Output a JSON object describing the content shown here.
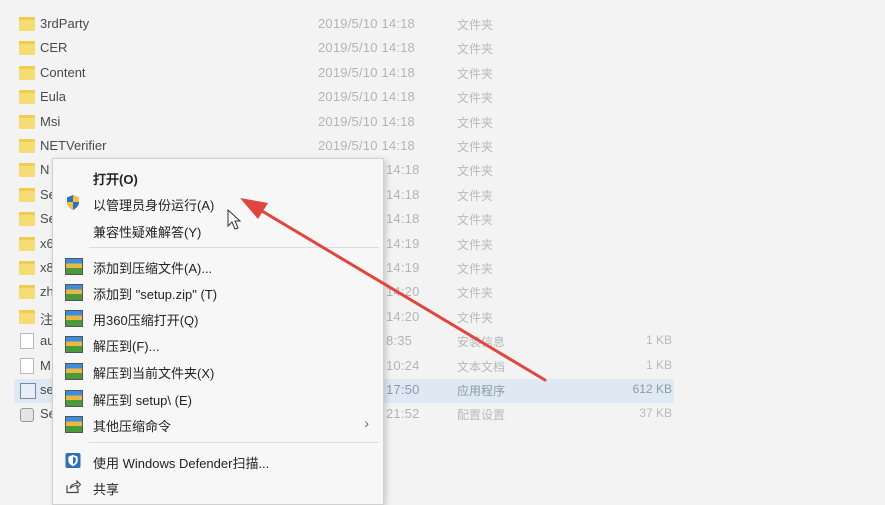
{
  "files": [
    {
      "name": "3rdParty",
      "date": "2019/5/10 14:18",
      "type": "文件夹",
      "size": "",
      "icon": "folder-icon"
    },
    {
      "name": "CER",
      "date": "2019/5/10 14:18",
      "type": "文件夹",
      "size": "",
      "icon": "folder-icon"
    },
    {
      "name": "Content",
      "date": "2019/5/10 14:18",
      "type": "文件夹",
      "size": "",
      "icon": "folder-icon"
    },
    {
      "name": "Eula",
      "date": "2019/5/10 14:18",
      "type": "文件夹",
      "size": "",
      "icon": "folder-icon"
    },
    {
      "name": "Msi",
      "date": "2019/5/10 14:18",
      "type": "文件夹",
      "size": "",
      "icon": "folder-icon"
    },
    {
      "name": "NETVerifier",
      "date": "2019/5/10 14:18",
      "type": "文件夹",
      "size": "",
      "icon": "folder-icon"
    },
    {
      "name": "N",
      "date": "14:18",
      "type": "文件夹",
      "size": "",
      "icon": "folder-icon"
    },
    {
      "name": "Se",
      "date": "14:18",
      "type": "文件夹",
      "size": "",
      "icon": "folder-icon"
    },
    {
      "name": "Se",
      "date": "14:18",
      "type": "文件夹",
      "size": "",
      "icon": "folder-icon"
    },
    {
      "name": "x6",
      "date": "14:19",
      "type": "文件夹",
      "size": "",
      "icon": "folder-icon"
    },
    {
      "name": "x8",
      "date": "14:19",
      "type": "文件夹",
      "size": "",
      "icon": "folder-icon"
    },
    {
      "name": "zh",
      "date": "14:20",
      "type": "文件夹",
      "size": "",
      "icon": "folder-icon"
    },
    {
      "name": "注",
      "date": "14:20",
      "type": "文件夹",
      "size": "",
      "icon": "folder-icon"
    },
    {
      "name": "au",
      "date": "8:35",
      "type": "安装信息",
      "size": "1 KB",
      "icon": "file-icon"
    },
    {
      "name": "M",
      "date": "10:24",
      "type": "文本文档",
      "size": "1 KB",
      "icon": "file-icon"
    },
    {
      "name": "se",
      "date": "17:50",
      "type": "应用程序",
      "size": "612 KB",
      "icon": "app-icon"
    },
    {
      "name": "Se",
      "date": "21:52",
      "type": "配置设置",
      "size": "37 KB",
      "icon": "settings-file-icon"
    }
  ],
  "menu": {
    "open": "打开(O)",
    "run_as_admin": "以管理员身份运行(A)",
    "compat": "兼容性疑难解答(Y)",
    "add_archive": "添加到压缩文件(A)...",
    "add_zip": "添加到 \"setup.zip\" (T)",
    "open_360": "用360压缩打开(Q)",
    "extract_to": "解压到(F)...",
    "extract_here": "解压到当前文件夹(X)",
    "extract_setup": "解压到 setup\\ (E)",
    "more_compress": "其他压缩命令",
    "defender": "使用 Windows Defender扫描...",
    "share": "共享",
    "submenu_arrow": "›"
  },
  "colors": {
    "arrow": "#e0463e",
    "selection": "#dfe9f4",
    "folder": "#f6dc74"
  }
}
